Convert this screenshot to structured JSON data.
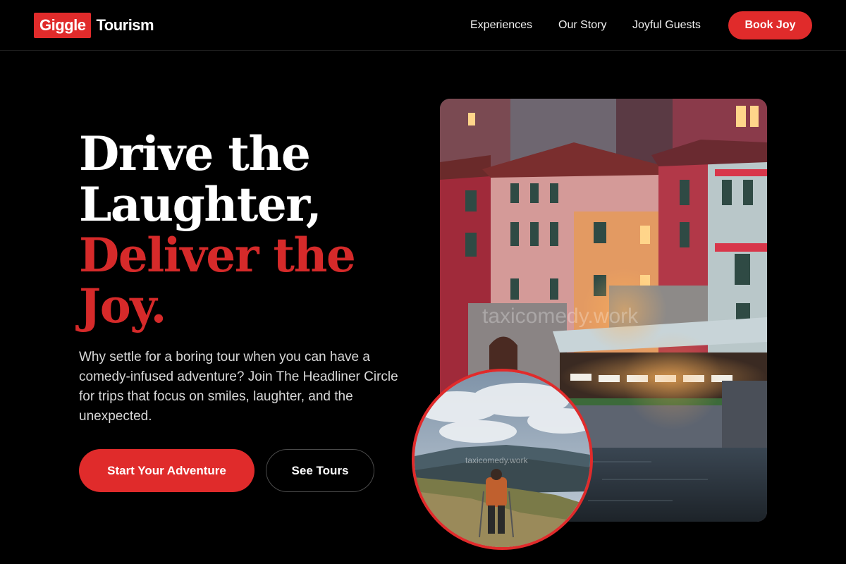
{
  "brand": {
    "badge": "Giggle",
    "name": "Tourism",
    "accent": "#e02b2b"
  },
  "nav": {
    "links": [
      "Experiences",
      "Our Story",
      "Joyful Guests"
    ],
    "cta": "Book Joy"
  },
  "hero": {
    "headline_white": [
      "Drive the",
      "Laughter,"
    ],
    "headline_red": [
      "Deliver the",
      "Joy."
    ],
    "description": "Why settle for a boring tour when you can have a comedy-infused adventure? Join The Headliner Circle for trips that focus on smiles, laughter, and the unexpected.",
    "primary_cta": "Start Your Adventure",
    "secondary_cta": "See Tours"
  },
  "images": {
    "main_watermark": "taxicomedy.work",
    "circle_watermark": "taxicomedy.work"
  }
}
